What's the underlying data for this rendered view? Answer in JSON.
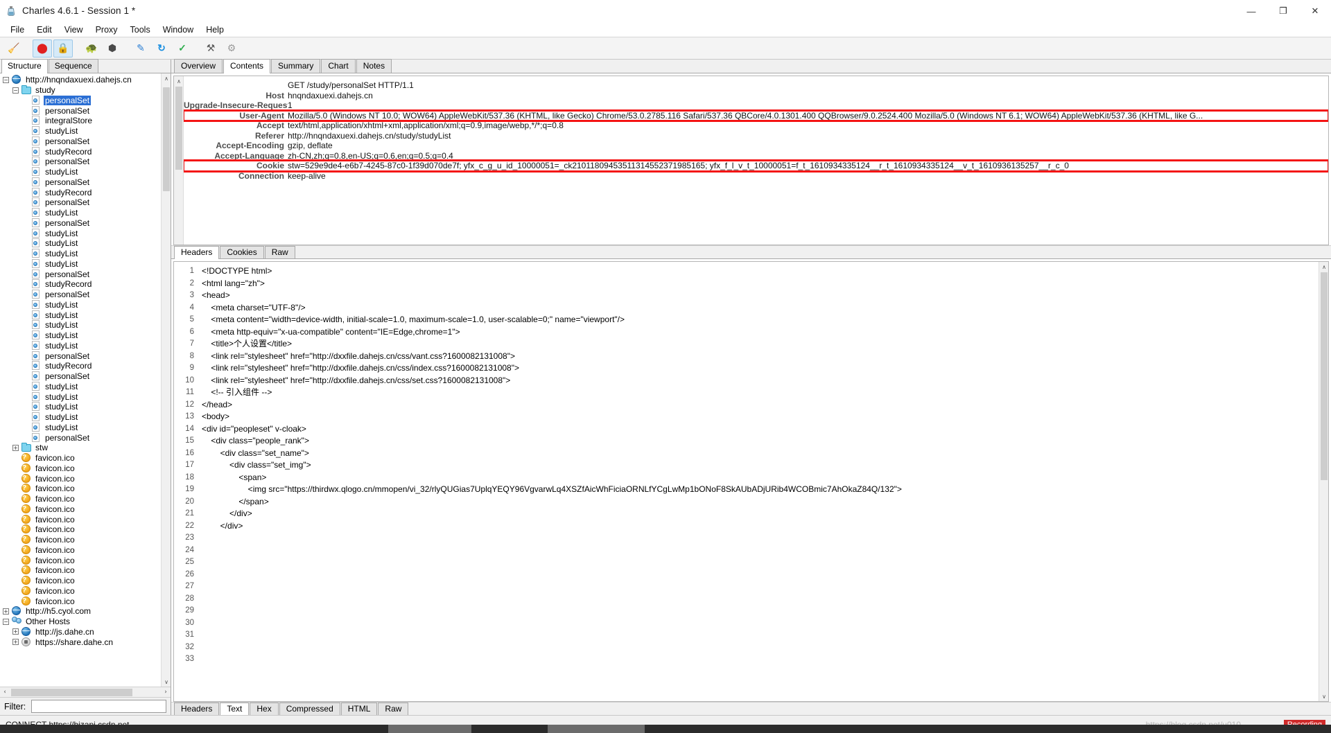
{
  "window": {
    "title": "Charles 4.6.1 - Session 1 *",
    "app_icon": "charles-bottle-icon",
    "minimize": "—",
    "maximize": "❐",
    "close": "✕"
  },
  "menubar": {
    "items": [
      "File",
      "Edit",
      "View",
      "Proxy",
      "Tools",
      "Window",
      "Help"
    ]
  },
  "toolbar": {
    "buttons": [
      {
        "name": "clear-session-icon",
        "glyph": "🧹",
        "selected": false
      },
      {
        "name": "record-stop-icon",
        "glyph": "⬤",
        "selected": true
      },
      {
        "name": "ssl-proxying-icon",
        "glyph": "🔒",
        "selected": true
      },
      {
        "name": "throttle-icon",
        "glyph": "🐢",
        "selected": false
      },
      {
        "name": "breakpoints-icon",
        "glyph": "⬢",
        "selected": false
      },
      {
        "name": "compose-icon",
        "glyph": "✎",
        "selected": false
      },
      {
        "name": "repeat-icon",
        "glyph": "↻",
        "selected": false
      },
      {
        "name": "validate-icon",
        "glyph": "✓",
        "selected": false
      },
      {
        "name": "tools-icon",
        "glyph": "⚒",
        "selected": false
      },
      {
        "name": "settings-icon",
        "glyph": "⚙",
        "selected": false
      }
    ]
  },
  "left_pane": {
    "tabs": [
      {
        "label": "Structure",
        "active": true
      },
      {
        "label": "Sequence",
        "active": false
      }
    ],
    "tree": [
      {
        "label": "http://hnqndaxuexi.dahejs.cn",
        "icon": "globe",
        "indent": 0,
        "twisty": "-",
        "selected": false
      },
      {
        "label": "study",
        "icon": "folder",
        "indent": 1,
        "twisty": "-",
        "selected": false
      },
      {
        "label": "personalSet",
        "icon": "doc",
        "indent": 2,
        "twisty": "",
        "selected": true
      },
      {
        "label": "personalSet",
        "icon": "doc",
        "indent": 2,
        "twisty": "",
        "selected": false
      },
      {
        "label": "integralStore",
        "icon": "doc",
        "indent": 2,
        "twisty": "",
        "selected": false
      },
      {
        "label": "studyList",
        "icon": "doc",
        "indent": 2,
        "twisty": "",
        "selected": false
      },
      {
        "label": "personalSet",
        "icon": "doc",
        "indent": 2,
        "twisty": "",
        "selected": false
      },
      {
        "label": "studyRecord",
        "icon": "doc",
        "indent": 2,
        "twisty": "",
        "selected": false
      },
      {
        "label": "personalSet",
        "icon": "doc",
        "indent": 2,
        "twisty": "",
        "selected": false
      },
      {
        "label": "studyList",
        "icon": "doc",
        "indent": 2,
        "twisty": "",
        "selected": false
      },
      {
        "label": "personalSet",
        "icon": "doc",
        "indent": 2,
        "twisty": "",
        "selected": false
      },
      {
        "label": "studyRecord",
        "icon": "doc",
        "indent": 2,
        "twisty": "",
        "selected": false
      },
      {
        "label": "personalSet",
        "icon": "doc",
        "indent": 2,
        "twisty": "",
        "selected": false
      },
      {
        "label": "studyList",
        "icon": "doc",
        "indent": 2,
        "twisty": "",
        "selected": false
      },
      {
        "label": "personalSet",
        "icon": "doc",
        "indent": 2,
        "twisty": "",
        "selected": false
      },
      {
        "label": "studyList",
        "icon": "doc",
        "indent": 2,
        "twisty": "",
        "selected": false
      },
      {
        "label": "studyList",
        "icon": "doc",
        "indent": 2,
        "twisty": "",
        "selected": false
      },
      {
        "label": "studyList",
        "icon": "doc",
        "indent": 2,
        "twisty": "",
        "selected": false
      },
      {
        "label": "studyList",
        "icon": "doc",
        "indent": 2,
        "twisty": "",
        "selected": false
      },
      {
        "label": "personalSet",
        "icon": "doc",
        "indent": 2,
        "twisty": "",
        "selected": false
      },
      {
        "label": "studyRecord",
        "icon": "doc",
        "indent": 2,
        "twisty": "",
        "selected": false
      },
      {
        "label": "personalSet",
        "icon": "doc",
        "indent": 2,
        "twisty": "",
        "selected": false
      },
      {
        "label": "studyList",
        "icon": "doc",
        "indent": 2,
        "twisty": "",
        "selected": false
      },
      {
        "label": "studyList",
        "icon": "doc",
        "indent": 2,
        "twisty": "",
        "selected": false
      },
      {
        "label": "studyList",
        "icon": "doc",
        "indent": 2,
        "twisty": "",
        "selected": false
      },
      {
        "label": "studyList",
        "icon": "doc",
        "indent": 2,
        "twisty": "",
        "selected": false
      },
      {
        "label": "studyList",
        "icon": "doc",
        "indent": 2,
        "twisty": "",
        "selected": false
      },
      {
        "label": "personalSet",
        "icon": "doc",
        "indent": 2,
        "twisty": "",
        "selected": false
      },
      {
        "label": "studyRecord",
        "icon": "doc",
        "indent": 2,
        "twisty": "",
        "selected": false
      },
      {
        "label": "personalSet",
        "icon": "doc",
        "indent": 2,
        "twisty": "",
        "selected": false
      },
      {
        "label": "studyList",
        "icon": "doc",
        "indent": 2,
        "twisty": "",
        "selected": false
      },
      {
        "label": "studyList",
        "icon": "doc",
        "indent": 2,
        "twisty": "",
        "selected": false
      },
      {
        "label": "studyList",
        "icon": "doc",
        "indent": 2,
        "twisty": "",
        "selected": false
      },
      {
        "label": "studyList",
        "icon": "doc",
        "indent": 2,
        "twisty": "",
        "selected": false
      },
      {
        "label": "studyList",
        "icon": "doc",
        "indent": 2,
        "twisty": "",
        "selected": false
      },
      {
        "label": "personalSet",
        "icon": "doc",
        "indent": 2,
        "twisty": "",
        "selected": false
      },
      {
        "label": "stw",
        "icon": "folder",
        "indent": 1,
        "twisty": "+",
        "selected": false
      },
      {
        "label": "favicon.ico",
        "icon": "unknown",
        "indent": 1,
        "twisty": "",
        "selected": false
      },
      {
        "label": "favicon.ico",
        "icon": "unknown",
        "indent": 1,
        "twisty": "",
        "selected": false
      },
      {
        "label": "favicon.ico",
        "icon": "unknown",
        "indent": 1,
        "twisty": "",
        "selected": false
      },
      {
        "label": "favicon.ico",
        "icon": "unknown",
        "indent": 1,
        "twisty": "",
        "selected": false
      },
      {
        "label": "favicon.ico",
        "icon": "unknown",
        "indent": 1,
        "twisty": "",
        "selected": false
      },
      {
        "label": "favicon.ico",
        "icon": "unknown",
        "indent": 1,
        "twisty": "",
        "selected": false
      },
      {
        "label": "favicon.ico",
        "icon": "unknown",
        "indent": 1,
        "twisty": "",
        "selected": false
      },
      {
        "label": "favicon.ico",
        "icon": "unknown",
        "indent": 1,
        "twisty": "",
        "selected": false
      },
      {
        "label": "favicon.ico",
        "icon": "unknown",
        "indent": 1,
        "twisty": "",
        "selected": false
      },
      {
        "label": "favicon.ico",
        "icon": "unknown",
        "indent": 1,
        "twisty": "",
        "selected": false
      },
      {
        "label": "favicon.ico",
        "icon": "unknown",
        "indent": 1,
        "twisty": "",
        "selected": false
      },
      {
        "label": "favicon.ico",
        "icon": "unknown",
        "indent": 1,
        "twisty": "",
        "selected": false
      },
      {
        "label": "favicon.ico",
        "icon": "unknown",
        "indent": 1,
        "twisty": "",
        "selected": false
      },
      {
        "label": "favicon.ico",
        "icon": "unknown",
        "indent": 1,
        "twisty": "",
        "selected": false
      },
      {
        "label": "favicon.ico",
        "icon": "unknown",
        "indent": 1,
        "twisty": "",
        "selected": false
      },
      {
        "label": "http://h5.cyol.com",
        "icon": "globe",
        "indent": 0,
        "twisty": "+",
        "selected": false
      },
      {
        "label": "Other Hosts",
        "icon": "hosts",
        "indent": 0,
        "twisty": "-",
        "selected": false
      },
      {
        "label": "http://js.dahe.cn",
        "icon": "globe",
        "indent": 1,
        "twisty": "+",
        "selected": false
      },
      {
        "label": "https://share.dahe.cn",
        "icon": "lock",
        "indent": 1,
        "twisty": "+",
        "selected": false
      }
    ],
    "filter": {
      "label": "Filter:",
      "value": "",
      "placeholder": ""
    },
    "scroll_up_glyph": "∧",
    "scroll_down_glyph": "∨",
    "scroll_left_glyph": "‹",
    "scroll_right_glyph": "›"
  },
  "right_pane": {
    "tabs": [
      {
        "label": "Overview",
        "active": false
      },
      {
        "label": "Contents",
        "active": true
      },
      {
        "label": "Summary",
        "active": false
      },
      {
        "label": "Chart",
        "active": false
      },
      {
        "label": "Notes",
        "active": false
      }
    ],
    "request": {
      "request_line": "GET /study/personalSet HTTP/1.1",
      "headers": [
        {
          "name": "Host",
          "value": "hnqndaxuexi.dahejs.cn",
          "highlight": false
        },
        {
          "name": "Upgrade-Insecure-Requests",
          "value": "1",
          "highlight": false
        },
        {
          "name": "User-Agent",
          "value": "Mozilla/5.0 (Windows NT 10.0; WOW64) AppleWebKit/537.36 (KHTML, like Gecko) Chrome/53.0.2785.116 Safari/537.36 QBCore/4.0.1301.400 QQBrowser/9.0.2524.400 Mozilla/5.0 (Windows NT 6.1; WOW64) AppleWebKit/537.36 (KHTML, like G...",
          "highlight": true
        },
        {
          "name": "Accept",
          "value": "text/html,application/xhtml+xml,application/xml;q=0.9,image/webp,*/*;q=0.8",
          "highlight": false
        },
        {
          "name": "Referer",
          "value": "http://hnqndaxuexi.dahejs.cn/study/studyList",
          "highlight": false
        },
        {
          "name": "Accept-Encoding",
          "value": "gzip, deflate",
          "highlight": false
        },
        {
          "name": "Accept-Language",
          "value": "zh-CN,zh;q=0.8,en-US;q=0.6,en;q=0.5;q=0.4",
          "highlight": false
        },
        {
          "name": "Cookie",
          "value": "stw=529e9de4-e6b7-4245-87c0-1f39d070de7f; yfx_c_g_u_id_10000051=_ck21011809453511314552371985165; yfx_f_l_v_t_10000051=f_t_1610934335124__r_t_1610934335124__v_t_1610936135257__r_c_0",
          "highlight": true
        },
        {
          "name": "Connection",
          "value": "keep-alive",
          "highlight": false
        }
      ],
      "subtabs": [
        {
          "label": "Headers",
          "active": true
        },
        {
          "label": "Cookies",
          "active": false
        },
        {
          "label": "Raw",
          "active": false
        }
      ]
    },
    "response": {
      "lines": [
        "<!DOCTYPE html>",
        "",
        "<html lang=\"zh\">",
        "",
        "<head>",
        "",
        "    <meta charset=\"UTF-8\"/>",
        "",
        "    <meta content=\"width=device-width, initial-scale=1.0, maximum-scale=1.0, user-scalable=0;\" name=\"viewport\"/>",
        "",
        "    <meta http-equiv=\"x-ua-compatible\" content=\"IE=Edge,chrome=1\">",
        "",
        "    <title>个人设置</title>",
        "",
        "    <link rel=\"stylesheet\" href=\"http://dxxfile.dahejs.cn/css/vant.css?1600082131008\">",
        "    <link rel=\"stylesheet\" href=\"http://dxxfile.dahejs.cn/css/index.css?1600082131008\">",
        "    <link rel=\"stylesheet\" href=\"http://dxxfile.dahejs.cn/css/set.css?1600082131008\">",
        "    <!-- 引入组件 -->",
        "",
        "",
        "</head>",
        "",
        "<body>",
        "",
        "<div id=\"peopleset\" v-cloak>",
        "    <div class=\"people_rank\">",
        "        <div class=\"set_name\">",
        "            <div class=\"set_img\">",
        "                <span>",
        "                    <img src=\"https://thirdwx.qlogo.cn/mmopen/vi_32/rlyQUGias7UplqYEQY96VgvarwLq4XSZfAicWhFiciaORNLfYCgLwMp1bONoF8SkAUbADjURib4WCOBmic7AhOkaZ84Q/132\">",
        "                </span>",
        "            </div>",
        "        </div>"
      ],
      "first_line_number": 1,
      "subtabs": [
        {
          "label": "Headers",
          "active": false
        },
        {
          "label": "Text",
          "active": true
        },
        {
          "label": "Hex",
          "active": false
        },
        {
          "label": "Compressed",
          "active": false
        },
        {
          "label": "HTML",
          "active": false
        },
        {
          "label": "Raw",
          "active": false
        }
      ]
    }
  },
  "statusbar": {
    "text": "CONNECT https://bizapi.csdn.net",
    "watermark": "https://blog.csdn.net/u010...",
    "recording_badge": "Recording"
  },
  "colors": {
    "accent": "#2b6fd4",
    "highlight_red": "#f41414",
    "selected_bg": "#2b6fd4",
    "toolbar_bg": "#f4f4f4",
    "panel_bg": "#ffffff"
  }
}
